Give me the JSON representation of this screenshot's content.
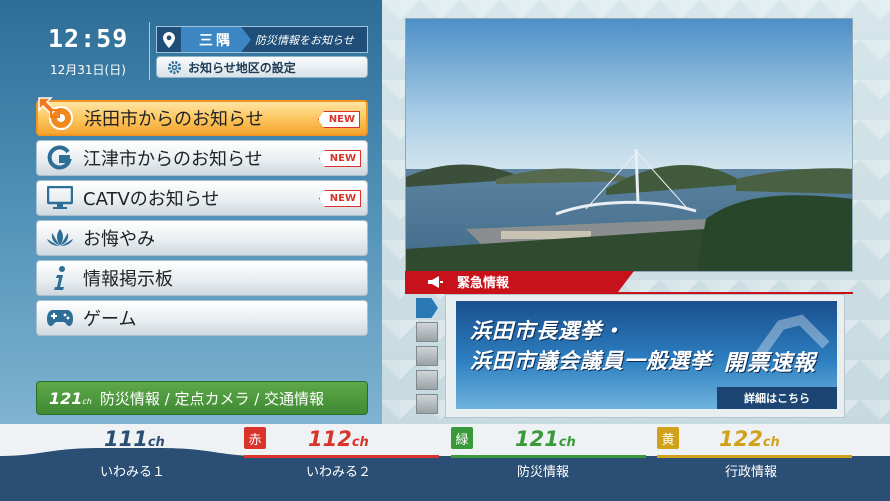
{
  "status": {
    "time": "12:59",
    "date": "12月31日(日)",
    "region_name": "三隅",
    "region_desc": "防災情報をお知らせ",
    "settings_label": "お知らせ地区の設定"
  },
  "menu": {
    "items": [
      {
        "label": "浜田市からのお知らせ",
        "badge": "NEW"
      },
      {
        "label": "江津市からのお知らせ",
        "badge": "NEW"
      },
      {
        "label": "CATVのお知らせ",
        "badge": "NEW"
      },
      {
        "label": "お悔やみ"
      },
      {
        "label": "情報掲示板"
      },
      {
        "label": "ゲーム"
      }
    ],
    "info_bar": {
      "channel": "121",
      "channel_unit": "ch",
      "text": "防災情報 / 定点カメラ / 交通情報"
    }
  },
  "main": {
    "emergency_label": "緊急情報",
    "banner": {
      "line1": "浜田市長選挙・",
      "line2": "浜田市議会議員一般選挙",
      "line2b": "開票速報",
      "link": "詳細はこちら"
    }
  },
  "channels": [
    {
      "number": "111",
      "unit": "ch",
      "name": "いわみる１",
      "color_tag": "",
      "color": "#2b4f74"
    },
    {
      "number": "112",
      "unit": "ch",
      "name": "いわみる２",
      "color_tag": "赤",
      "color": "#d9342b"
    },
    {
      "number": "121",
      "unit": "ch",
      "name": "防災情報",
      "color_tag": "緑",
      "color": "#3a9a3a"
    },
    {
      "number": "122",
      "unit": "ch",
      "name": "行政情報",
      "color_tag": "黄",
      "color": "#d1a11a"
    }
  ],
  "colors": {
    "accent": "#f5a532",
    "alert": "#c8121b",
    "navy": "#2b4f74"
  }
}
